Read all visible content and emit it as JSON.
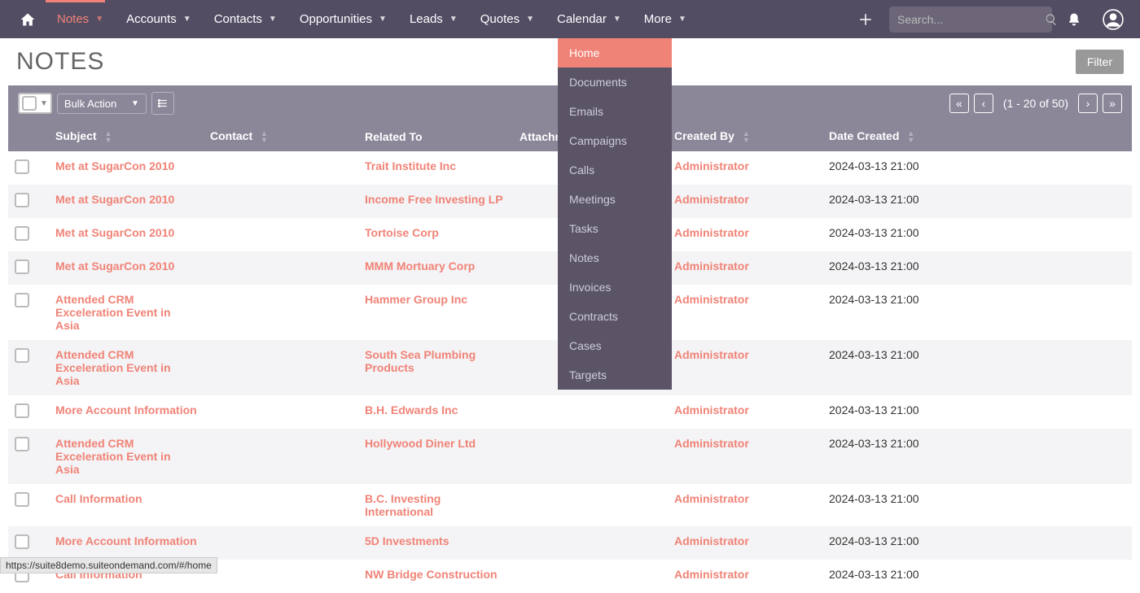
{
  "nav": {
    "items": [
      {
        "label": "Notes",
        "active": true
      },
      {
        "label": "Accounts"
      },
      {
        "label": "Contacts"
      },
      {
        "label": "Opportunities"
      },
      {
        "label": "Leads"
      },
      {
        "label": "Quotes"
      },
      {
        "label": "Calendar"
      },
      {
        "label": "More"
      }
    ],
    "search_placeholder": "Search..."
  },
  "dropdown": {
    "items": [
      {
        "label": "Home",
        "highlighted": true
      },
      {
        "label": "Documents"
      },
      {
        "label": "Emails"
      },
      {
        "label": "Campaigns"
      },
      {
        "label": "Calls"
      },
      {
        "label": "Meetings"
      },
      {
        "label": "Tasks"
      },
      {
        "label": "Notes"
      },
      {
        "label": "Invoices"
      },
      {
        "label": "Contracts"
      },
      {
        "label": "Cases"
      },
      {
        "label": "Targets"
      }
    ]
  },
  "page": {
    "title": "NOTES",
    "filter_label": "Filter"
  },
  "toolbar": {
    "bulk_action_label": "Bulk Action",
    "pager_text": "(1 - 20 of 50)"
  },
  "columns": {
    "subject": "Subject",
    "contact": "Contact",
    "related": "Related To",
    "attachment": "Attachment",
    "created_by": "Created By",
    "date_created": "Date Created"
  },
  "rows": [
    {
      "subject": "Met at SugarCon 2010",
      "contact": "",
      "related": "Trait Institute Inc",
      "attachment": "",
      "created_by": "Administrator",
      "date_created": "2024-03-13 21:00"
    },
    {
      "subject": "Met at SugarCon 2010",
      "contact": "",
      "related": "Income Free Investing LP",
      "attachment": "",
      "created_by": "Administrator",
      "date_created": "2024-03-13 21:00"
    },
    {
      "subject": "Met at SugarCon 2010",
      "contact": "",
      "related": "Tortoise Corp",
      "attachment": "",
      "created_by": "Administrator",
      "date_created": "2024-03-13 21:00"
    },
    {
      "subject": "Met at SugarCon 2010",
      "contact": "",
      "related": "MMM Mortuary Corp",
      "attachment": "",
      "created_by": "Administrator",
      "date_created": "2024-03-13 21:00"
    },
    {
      "subject": "Attended CRM Exceleration Event in Asia",
      "contact": "",
      "related": "Hammer Group Inc",
      "attachment": "",
      "created_by": "Administrator",
      "date_created": "2024-03-13 21:00"
    },
    {
      "subject": "Attended CRM Exceleration Event in Asia",
      "contact": "",
      "related": "South Sea Plumbing Products",
      "attachment": "",
      "created_by": "Administrator",
      "date_created": "2024-03-13 21:00"
    },
    {
      "subject": "More Account Information",
      "contact": "",
      "related": "B.H. Edwards Inc",
      "attachment": "",
      "created_by": "Administrator",
      "date_created": "2024-03-13 21:00"
    },
    {
      "subject": "Attended CRM Exceleration Event in Asia",
      "contact": "",
      "related": "Hollywood Diner Ltd",
      "attachment": "",
      "created_by": "Administrator",
      "date_created": "2024-03-13 21:00"
    },
    {
      "subject": "Call Information",
      "contact": "",
      "related": "B.C. Investing International",
      "attachment": "",
      "created_by": "Administrator",
      "date_created": "2024-03-13 21:00"
    },
    {
      "subject": "More Account Information",
      "contact": "",
      "related": "5D Investments",
      "attachment": "",
      "created_by": "Administrator",
      "date_created": "2024-03-13 21:00"
    },
    {
      "subject": "Call Information",
      "contact": "",
      "related": "NW Bridge Construction",
      "attachment": "",
      "created_by": "Administrator",
      "date_created": "2024-03-13 21:00"
    }
  ],
  "status_url": "https://suite8demo.suiteondemand.com/#/home"
}
